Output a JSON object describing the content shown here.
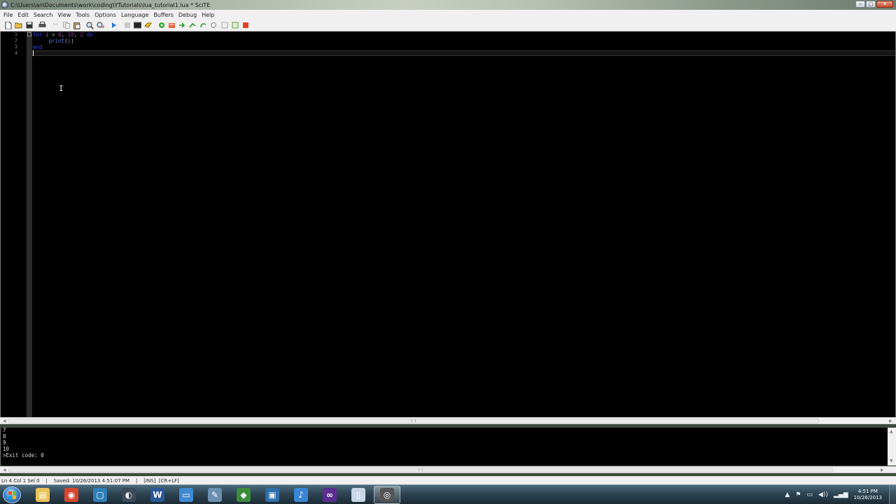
{
  "window": {
    "title": "C:\\Users\\an\\Documents\\work\\coding\\YTutorials\\lua_tutorial1.lua * SciTE",
    "controls": {
      "minimize": "−",
      "maximize": "□",
      "close": "✕"
    }
  },
  "menu": {
    "items": [
      "File",
      "Edit",
      "Search",
      "View",
      "Tools",
      "Options",
      "Language",
      "Buffers",
      "Debug",
      "Help"
    ]
  },
  "toolbar": {
    "icons": [
      "new-file-icon",
      "open-folder-icon",
      "save-icon",
      "print-icon",
      "cut-icon",
      "copy-icon",
      "paste-icon",
      "find-icon",
      "replace-icon",
      "go-icon",
      "stop-icon",
      "terminal-icon",
      "build-icon",
      "compile-icon",
      "tools-icon",
      "next-icon",
      "jump-icon",
      "previous-icon",
      "zoom-icon",
      "clear-icon",
      "window-icon",
      "close-red-icon"
    ]
  },
  "editor": {
    "line_numbers": [
      "1",
      "2",
      "3",
      "4"
    ],
    "lines": [
      {
        "indent": "",
        "tokens": [
          {
            "t": "for",
            "c": "kw"
          },
          {
            "t": " i ",
            "c": "ident"
          },
          {
            "t": "=",
            "c": "op"
          },
          {
            "t": " 0",
            "c": "num"
          },
          {
            "t": ",",
            "c": "op"
          },
          {
            "t": " 10",
            "c": "num"
          },
          {
            "t": ",",
            "c": "op"
          },
          {
            "t": " 2",
            "c": "num"
          },
          {
            "t": " do",
            "c": "kw"
          }
        ]
      },
      {
        "indent": "     ",
        "tokens": [
          {
            "t": "print",
            "c": "ident"
          },
          {
            "t": "(",
            "c": "op"
          },
          {
            "t": "i",
            "c": "ident"
          },
          {
            "t": ")",
            "c": "op"
          }
        ]
      },
      {
        "indent": "",
        "tokens": [
          {
            "t": "end",
            "c": "kw"
          }
        ]
      },
      {
        "indent": "",
        "tokens": []
      }
    ]
  },
  "output": {
    "lines": [
      "7",
      "8",
      "9",
      "10",
      ">Exit code: 0"
    ]
  },
  "statusbar": {
    "text": "Ln 4 Col 1 Sel 0    |    Saved: 10/26/2013 4:51:07 PM    |    [INS]  [CR+LF]"
  },
  "taskbar": {
    "apps": [
      {
        "name": "explorer-app-icon",
        "glyph": "▤",
        "bg": "#e8c25a"
      },
      {
        "name": "chrome-app-icon",
        "glyph": "◉",
        "bg": "#d8452f"
      },
      {
        "name": "notepad-app-icon",
        "glyph": "▢",
        "bg": "#2f7fb8"
      },
      {
        "name": "steam-app-icon",
        "glyph": "◐",
        "bg": "#3c4a5a"
      },
      {
        "name": "word-app-icon",
        "glyph": "W",
        "bg": "#2b5797"
      },
      {
        "name": "document-app-icon",
        "glyph": "▭",
        "bg": "#3f8ad0"
      },
      {
        "name": "paint-app-icon",
        "glyph": "✎",
        "bg": "#6b8fb0"
      },
      {
        "name": "green-app-icon",
        "glyph": "◆",
        "bg": "#3c8c3c"
      },
      {
        "name": "media-app-icon",
        "glyph": "▣",
        "bg": "#2e6fa8"
      },
      {
        "name": "itunes-app-icon",
        "glyph": "♪",
        "bg": "#3a86d4"
      },
      {
        "name": "visual-studio-app-icon",
        "glyph": "∞",
        "bg": "#5c2d91"
      },
      {
        "name": "blank-app-icon",
        "glyph": "▯",
        "bg": "#c8d6e6"
      },
      {
        "name": "scite-app-icon",
        "glyph": "◎",
        "bg": "#555555"
      }
    ],
    "tray_icons": [
      "▲",
      "⚑",
      "▭",
      "◀))",
      "▂▄▆"
    ],
    "clock_time": "4:51 PM",
    "clock_date": "10/26/2013"
  }
}
